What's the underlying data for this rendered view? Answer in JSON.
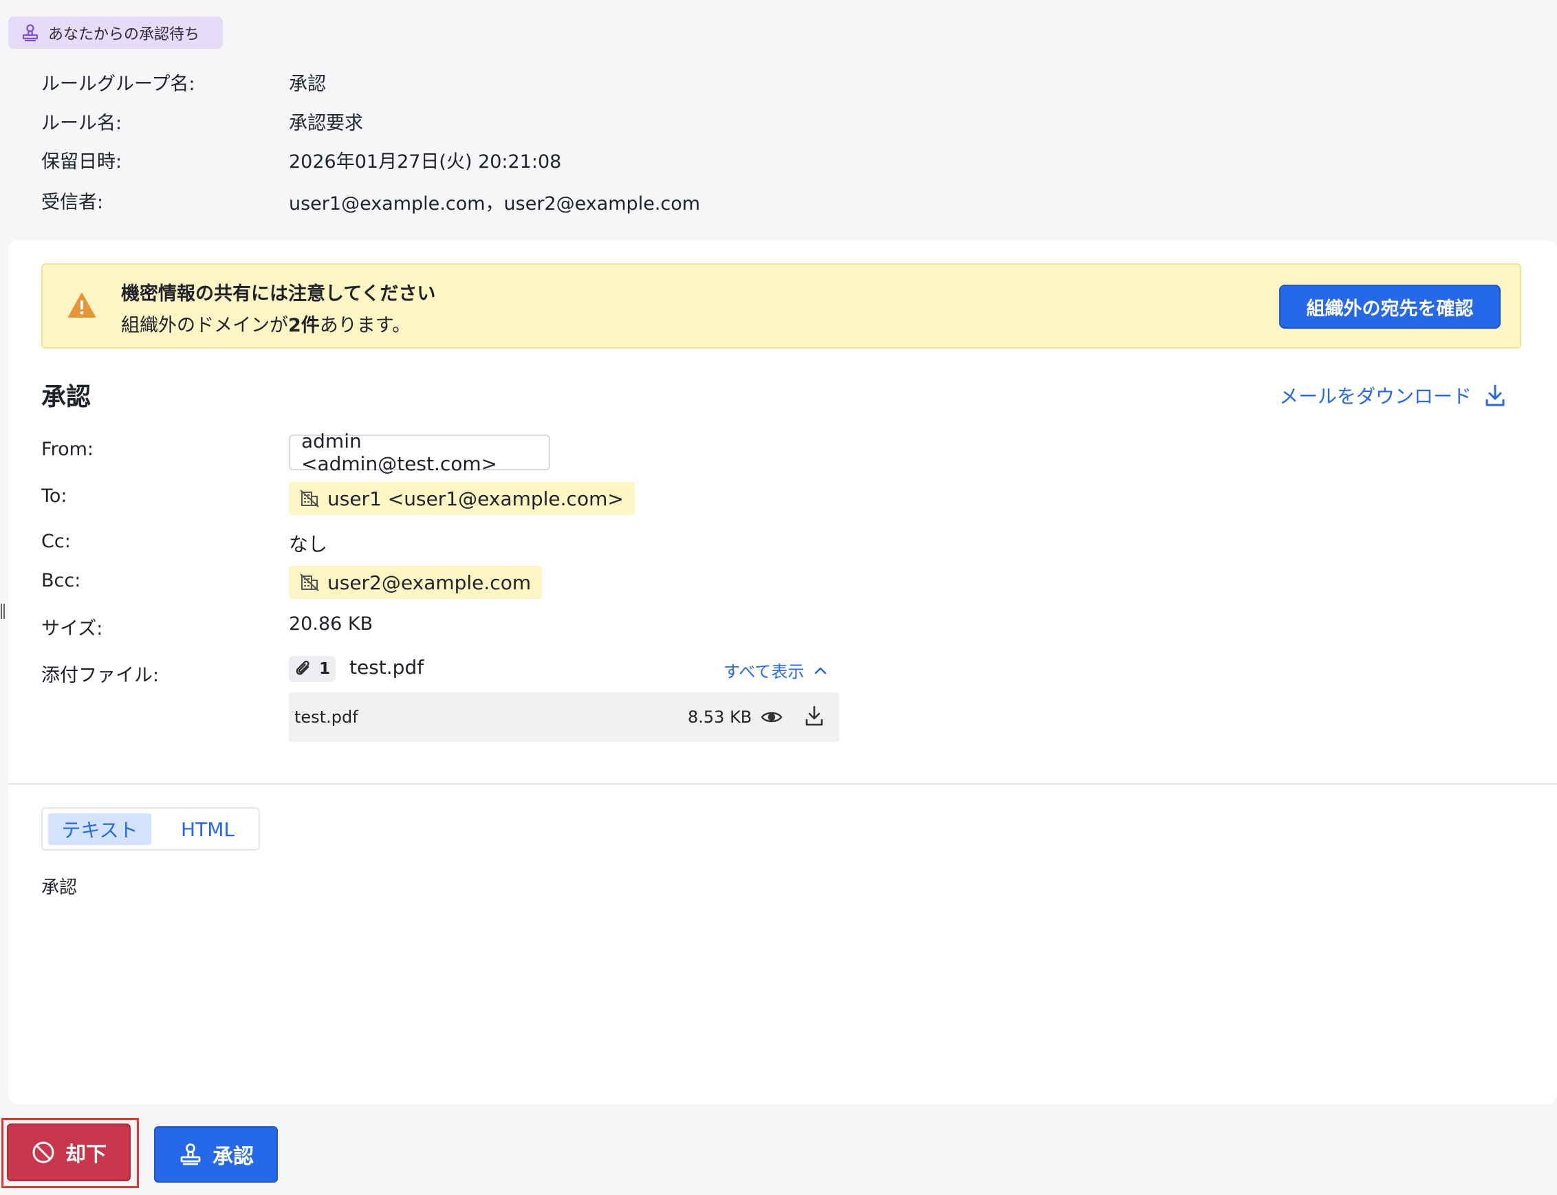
{
  "status_badge": {
    "label": "あなたからの承認待ち",
    "icon": "stamp-icon",
    "color": "#e6dcfa"
  },
  "meta": {
    "rule_group_label": "ルールグループ名:",
    "rule_group_value": "承認",
    "rule_name_label": "ルール名:",
    "rule_name_value": "承認要求",
    "held_at_label": "保留日時:",
    "held_at_value": "2026年01月27日(火) 20:21:08",
    "recipients_label": "受信者:",
    "recipients_value": "user1@example.com，user2@example.com"
  },
  "warning": {
    "title": "機密情報の共有には注意してください",
    "text_prefix": "組織外のドメインが",
    "count_text": "2件",
    "text_suffix": "あります。",
    "button_label": "組織外の宛先を確認",
    "icon": "warning-triangle-icon",
    "background": "#fdf5c3"
  },
  "mail": {
    "title": "承認",
    "download_label": "メールをダウンロード",
    "from_label": "From:",
    "from_value": "admin <admin@test.com>",
    "to_label": "To:",
    "to_value": "user1 <user1@example.com>",
    "cc_label": "Cc:",
    "cc_value": "なし",
    "bcc_label": "Bcc:",
    "bcc_value": "user2@example.com",
    "size_label": "サイズ:",
    "size_value": "20.86 KB",
    "attachments_label": "添付ファイル:",
    "attachment_count": "1",
    "attachment_summary_name": "test.pdf",
    "show_all_label": "すべて表示",
    "files": [
      {
        "name": "test.pdf",
        "size": "8.53 KB"
      }
    ]
  },
  "tabs": {
    "text_label": "テキスト",
    "html_label": "HTML",
    "active": "テキスト"
  },
  "body": {
    "text": "承認"
  },
  "actions": {
    "reject_label": "却下",
    "approve_label": "承認",
    "reject_color": "#c9354a",
    "approve_color": "#2568e8"
  }
}
